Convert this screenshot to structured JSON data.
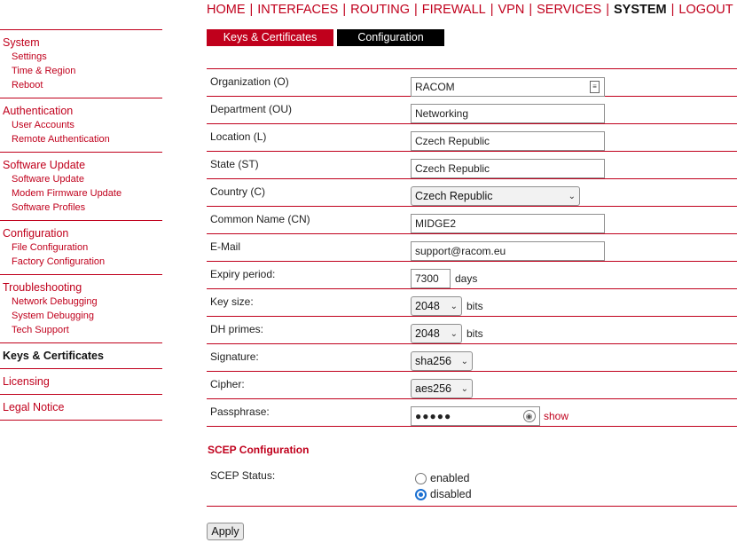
{
  "topnav": [
    {
      "label": "HOME",
      "active": false
    },
    {
      "label": "INTERFACES",
      "active": false
    },
    {
      "label": "ROUTING",
      "active": false
    },
    {
      "label": "FIREWALL",
      "active": false
    },
    {
      "label": "VPN",
      "active": false
    },
    {
      "label": "SERVICES",
      "active": false
    },
    {
      "label": "SYSTEM",
      "active": true
    },
    {
      "label": "LOGOUT",
      "active": false
    }
  ],
  "sidebar": {
    "system": {
      "title": "System",
      "items": [
        "Settings",
        "Time & Region",
        "Reboot"
      ]
    },
    "authentication": {
      "title": "Authentication",
      "items": [
        "User Accounts",
        "Remote Authentication"
      ]
    },
    "software_update": {
      "title": "Software Update",
      "items": [
        "Software Update",
        "Modem Firmware Update",
        "Software Profiles"
      ]
    },
    "configuration": {
      "title": "Configuration",
      "items": [
        "File Configuration",
        "Factory Configuration"
      ]
    },
    "troubleshooting": {
      "title": "Troubleshooting",
      "items": [
        "Network Debugging",
        "System Debugging",
        "Tech Support"
      ]
    },
    "keys": {
      "title": "Keys & Certificates"
    },
    "licensing": {
      "title": "Licensing"
    },
    "legal": {
      "title": "Legal Notice"
    }
  },
  "tabs": {
    "keys": "Keys & Certificates",
    "config": "Configuration"
  },
  "form": {
    "organization": {
      "label": "Organization (O)",
      "value": "RACOM"
    },
    "department": {
      "label": "Department (OU)",
      "value": "Networking"
    },
    "location": {
      "label": "Location (L)",
      "value": "Czech Republic"
    },
    "state": {
      "label": "State (ST)",
      "value": "Czech Republic"
    },
    "country": {
      "label": "Country (C)",
      "value": "Czech Republic"
    },
    "common_name": {
      "label": "Common Name (CN)",
      "value": "MIDGE2"
    },
    "email": {
      "label": "E-Mail",
      "value": "support@racom.eu"
    },
    "expiry": {
      "label": "Expiry period:",
      "value": "7300",
      "unit": "days"
    },
    "key_size": {
      "label": "Key size:",
      "value": "2048",
      "unit": "bits"
    },
    "dh_primes": {
      "label": "DH primes:",
      "value": "2048",
      "unit": "bits"
    },
    "signature": {
      "label": "Signature:",
      "value": "sha256"
    },
    "cipher": {
      "label": "Cipher:",
      "value": "aes256"
    },
    "passphrase": {
      "label": "Passphrase:",
      "value": "●●●●●",
      "show_label": "show"
    }
  },
  "scep": {
    "title": "SCEP Configuration",
    "status_label": "SCEP Status:",
    "enabled_label": "enabled",
    "disabled_label": "disabled",
    "selected": "disabled"
  },
  "apply_label": "Apply"
}
